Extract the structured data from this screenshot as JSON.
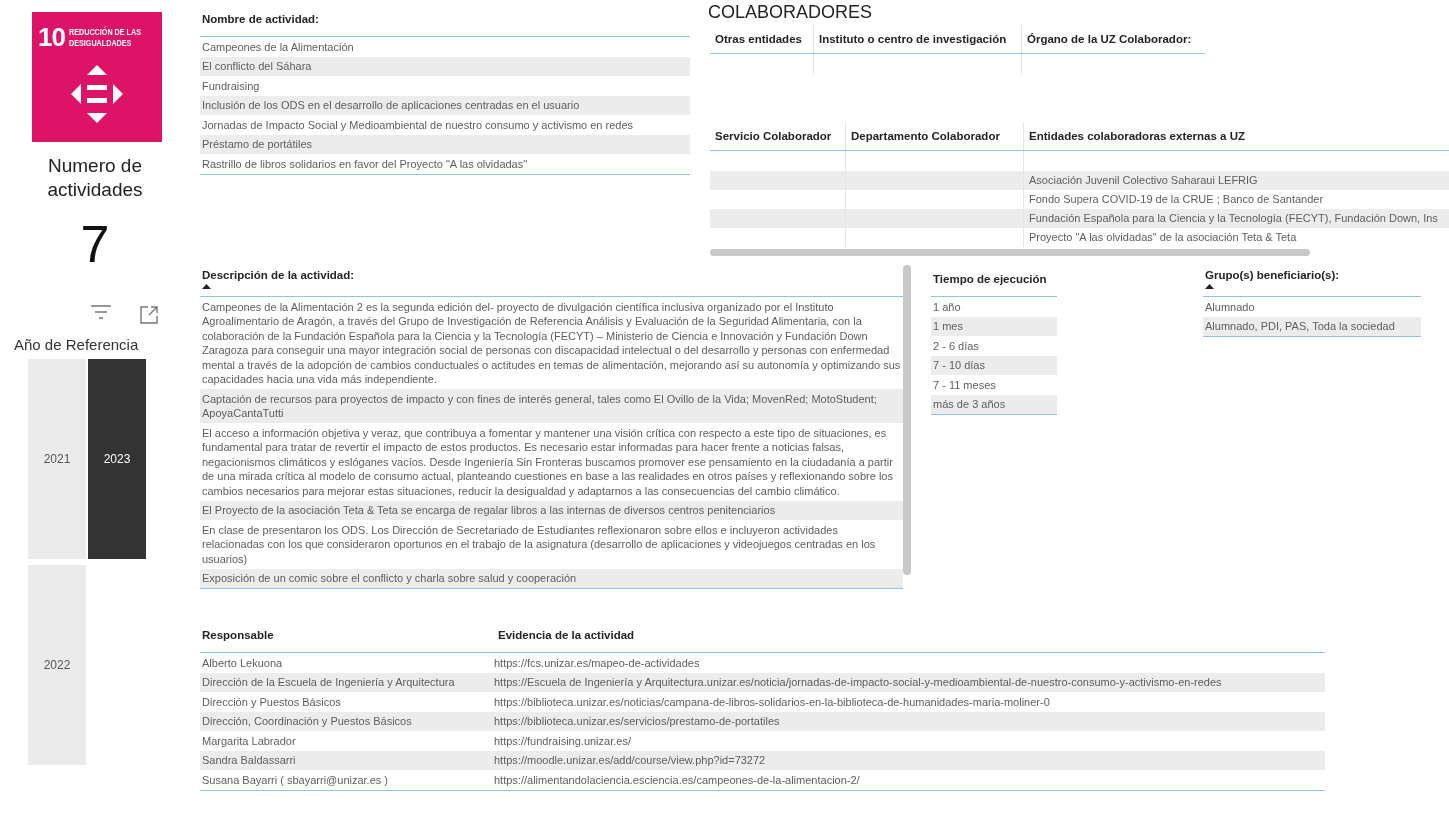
{
  "sdg_card": {
    "number": "10",
    "title_lines": [
      "REDUCCIÓN DE LAS",
      "DESIGUALDADES"
    ]
  },
  "kpi": {
    "label": "Numero de actividades",
    "value": "7"
  },
  "year_slicer": {
    "title": "Año de Referencia",
    "years": [
      {
        "label": "2021",
        "selected": false
      },
      {
        "label": "2023",
        "selected": true
      },
      {
        "label": "2022",
        "selected": false
      }
    ]
  },
  "activities_table": {
    "column": "Nombre de actividad:",
    "sorted": false,
    "rows": [
      "Campeones de la Alimentación",
      "El conflicto del Sáhara",
      "Fundraising",
      "Inclusión de los ODS en el desarrollo de aplicaciones centradas en el usuario",
      "Jornadas de Impacto Social y Medioambiental de nuestro consumo y activismo en redes",
      "Préstamo de portátiles",
      "Rastrillo de libros solidarios en favor del Proyecto \"A las olvidadas\""
    ]
  },
  "collaborators": {
    "title": "COLABORADORES",
    "table_1": {
      "columns": [
        "Otras entidades",
        "Instituto o centro de investigación",
        "Órgano de la UZ Colaborador:"
      ]
    },
    "table_2": {
      "columns": [
        "Servicio Colaborador",
        "Departamento Colaborador",
        "Entidades colaboradoras externas a UZ"
      ],
      "rows": [
        "Asociación Juvenil Colectivo Saharaui LEFRIG",
        "Fondo Supera COVID-19 de la CRUE ; Banco de Santander",
        "Fundación Española para la Ciencia y la Tecnología (FECYT), Fundación Down, Ins",
        "Proyecto \"A las olvidadas\" de la asociación Teta & Teta"
      ]
    }
  },
  "description_table": {
    "column": "Descripción de la actividad:",
    "sorted": true,
    "rows": [
      "Campeones de la Alimentación 2 es la segunda edición del- proyecto de divulgación científica inclusiva organizado por el Instituto Agroalimentario de Aragón, a través del Grupo de Investigación de Referencia Análisis y Evaluación de la Seguridad Alimentaria, con la colaboración de la Fundación Española para la Ciencia y la Tecnología (FECYT) – Ministerio de Ciencia e Innovación y Fundación Down Zaragoza para conseguir una mayor integración social de personas con discapacidad intelectual o del desarrollo y personas con enfermedad mental a través de la adopción de cambios conductuales o actitudes en temas de alimentación, mejorando así su autonomía y optimizando sus capacidades hacia una vida más independiente.",
      "Captación de recursos para proyectos de impacto y con fines de interés general, tales como El Ovillo de la Vida; MovenRed; MotoStudent; ApoyaCantaTutti",
      "El acceso a información objetiva y veraz, que contribuya a fomentar y mantener una visión crítica con respecto a este tipo de situaciones, es fundamental para tratar de revertir el impacto de estos productos. Es necesario estar informadas para hacer frente a noticias falsas, negacionismos climáticos y eslóganes vacíos. Desde Ingeniería Sin Fronteras buscamos promover ese pensamiento en la ciudadanía a partir de una mirada crítica al modelo de consumo actual, planteando cuestiones en base a las realidades en otros países y reflexionando sobre los cambios necesarios para mejorar estas situaciones, reducir la desigualdad y adaptarnos a las consecuencias del cambio climático.",
      "El Proyecto de la asociación Teta & Teta se encarga de regalar libros a las internas de diversos centros penitenciarios",
      "En clase de presentaron los ODS. Los Dirección de Secretariado de Estudiantes reflexionaron sobre ellos e incluyeron actividades relacionadas con los que consideraron oportunos en el trabajo de la asignatura (desarrollo de aplicaciones y videojuegos centradas en los usuarios)",
      "Exposición de un comic sobre el conflicto y charla sobre salud y cooperación"
    ]
  },
  "execution_time_table": {
    "column": "Tiempo de ejecución",
    "sorted": false,
    "rows": [
      "1 año",
      "1 mes",
      "2 - 6 días",
      "7 - 10 días",
      "7 - 11 meses",
      "más de 3 años"
    ]
  },
  "beneficiaries_table": {
    "column": "Grupo(s) beneficiario(s):",
    "sorted": true,
    "rows": [
      "Alumnado",
      "Alumnado, PDI, PAS, Toda la sociedad"
    ]
  },
  "responsible_table": {
    "columns": [
      "Responsable",
      "Evidencia de la actividad"
    ],
    "rows": [
      [
        "Alberto Lekuona",
        "https://fcs.unizar.es/mapeo-de-actividades"
      ],
      [
        "Dirección de la Escuela de Ingeniería y Arquitectura",
        "https://Escuela de Ingeniería y Arquitectura.unizar.es/noticia/jornadas-de-impacto-social-y-medioambiental-de-nuestro-consumo-y-activismo-en-redes"
      ],
      [
        "Dirección y Puestos Básicos",
        "https://biblioteca.unizar.es/noticias/campana-de-libros-solidarios-en-la-biblioteca-de-humanidades-maria-moliner-0"
      ],
      [
        "Dirección, Coordinación y Puestos Básicos",
        "https://biblioteca.unizar.es/servicios/prestamo-de-portatiles"
      ],
      [
        "Margarita Labrador",
        "https://fundraising.unizar.es/"
      ],
      [
        "Sandra Baldassarri",
        "https://moodle.unizar.es/add/course/view.php?id=73272"
      ],
      [
        "Susana Bayarri ( sbayarri@unizar.es )",
        "https://alimentandolaciencia.esciencia.es/campeones-de-la-alimentacion-2/"
      ]
    ]
  }
}
